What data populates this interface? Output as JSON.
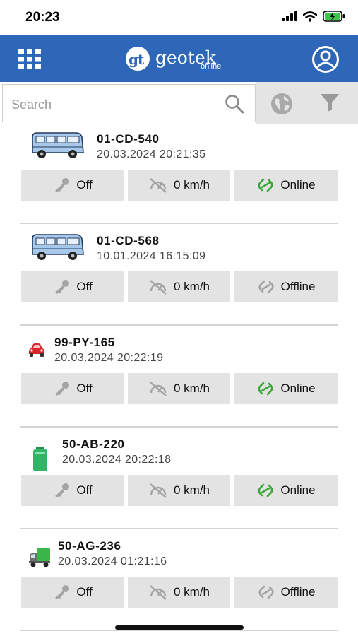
{
  "status_bar": {
    "time": "20:23",
    "icons": [
      "signal-icon",
      "wifi-icon",
      "battery-charging-icon"
    ]
  },
  "header": {
    "logo_text": "geotek",
    "logo_sub": "online",
    "icons": [
      "grid-menu-icon",
      "profile-icon"
    ]
  },
  "search": {
    "placeholder": "Search",
    "value": ""
  },
  "colors": {
    "header_bg": "#2e67b8",
    "online_green": "#3aa836",
    "offline_gray": "#9a9a9a",
    "pill_bg": "#e3e3e3"
  },
  "vehicles": [
    {
      "icon": "van-icon",
      "plate": "01-CD-540",
      "timestamp": "20.03.2024 20:21:35",
      "ignition": "Off",
      "speed": "0 km/h",
      "connection": "Online"
    },
    {
      "icon": "van-icon",
      "plate": "01-CD-568",
      "timestamp": "10.01.2024 16:15:09",
      "ignition": "Off",
      "speed": "0 km/h",
      "connection": "Offline"
    },
    {
      "icon": "red-car-icon",
      "plate": "99-PY-165",
      "timestamp": "20.03.2024 20:22:19",
      "ignition": "Off",
      "speed": "0 km/h",
      "connection": "Online"
    },
    {
      "icon": "green-tracker-icon",
      "plate": "50-AB-220",
      "timestamp": "20.03.2024 20:22:18",
      "ignition": "Off",
      "speed": "0 km/h",
      "connection": "Online"
    },
    {
      "icon": "green-truck-icon",
      "plate": "50-AG-236",
      "timestamp": "20.03.2024 01:21:16",
      "ignition": "Off",
      "speed": "0 km/h",
      "connection": "Offline"
    }
  ]
}
